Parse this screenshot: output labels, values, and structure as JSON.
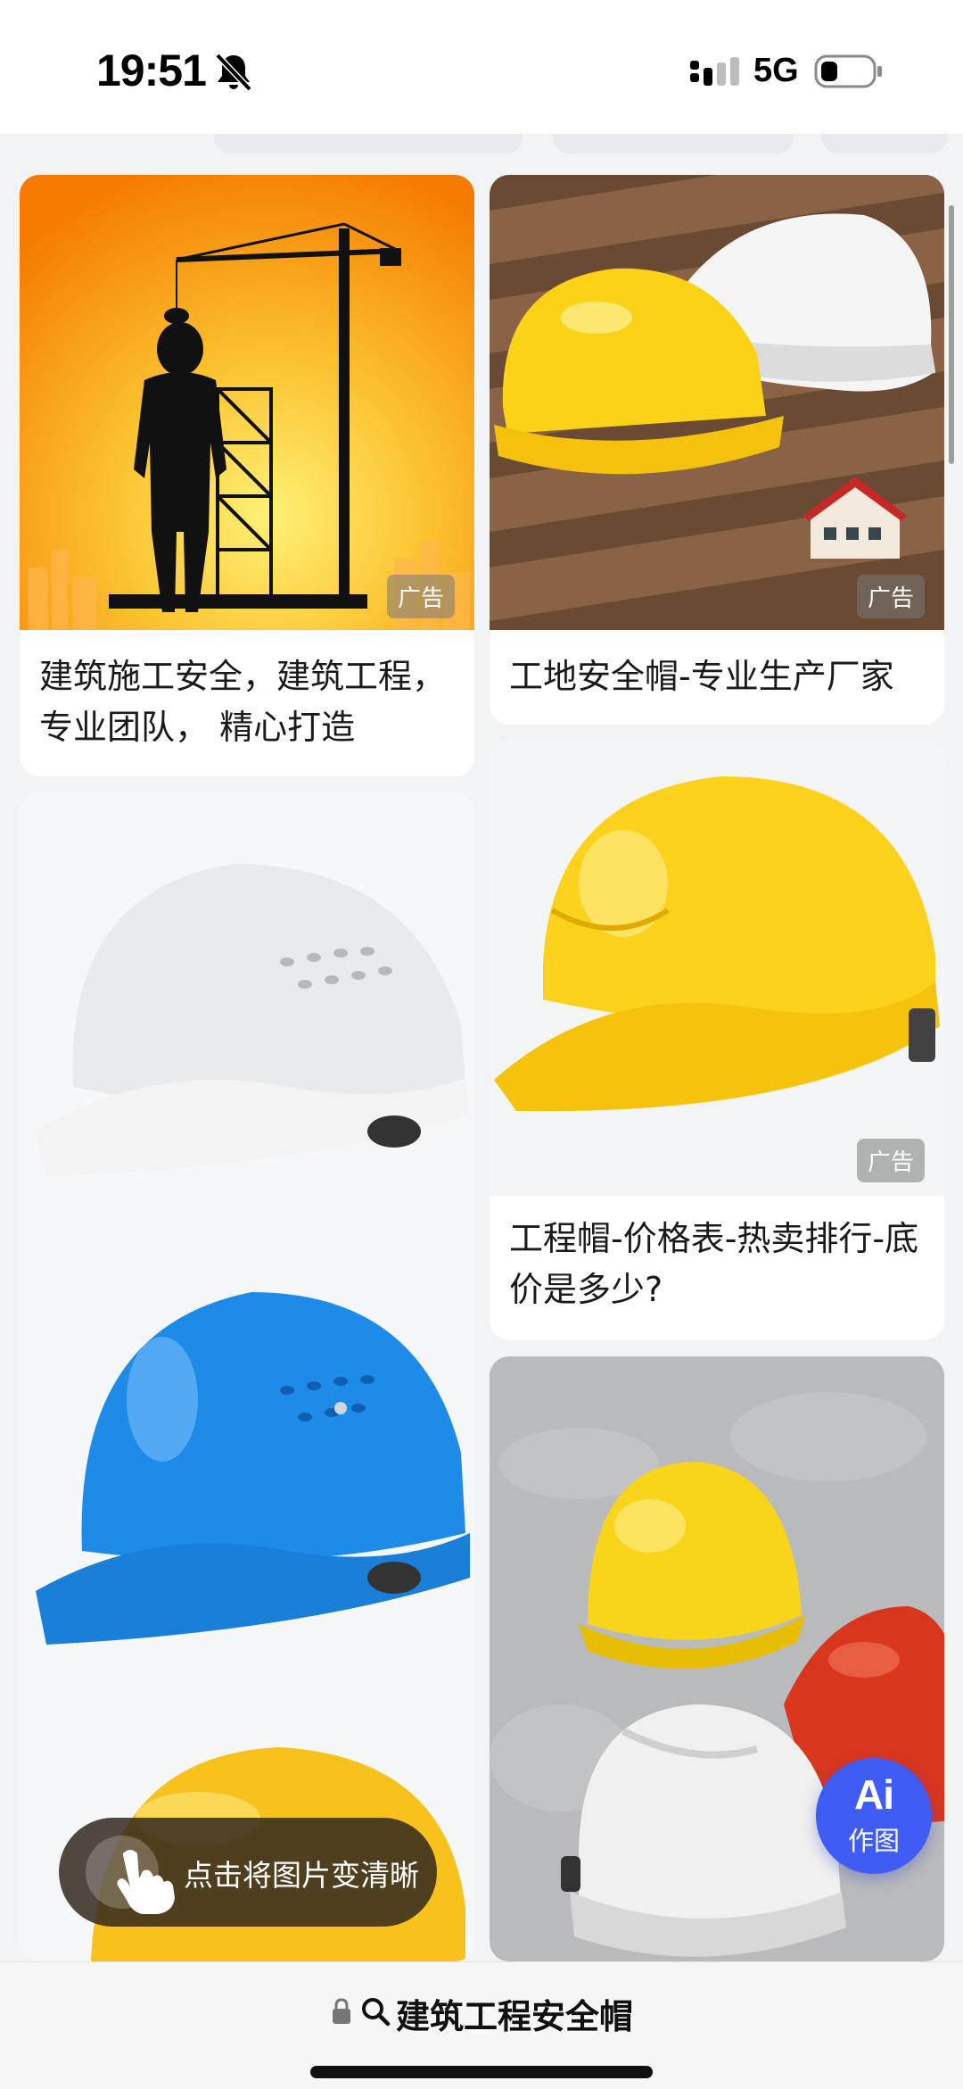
{
  "status_bar": {
    "time": "19:51",
    "network": "5G",
    "icons": [
      "bell-mute-icon",
      "signal-icon",
      "battery-icon"
    ]
  },
  "feed": {
    "cards": [
      {
        "title": "建筑施工安全，建筑工程，专业团队， 精心打造",
        "ad_label": "广告"
      },
      {
        "title": "工地安全帽-专业生产厂家",
        "ad_label": "广告"
      },
      {
        "title": "",
        "ad_label": ""
      },
      {
        "title": "工程帽-价格表-热卖排行-底价是多少?",
        "ad_label": "广告"
      },
      {
        "title": "",
        "ad_label": ""
      }
    ]
  },
  "tip": {
    "text": "点击将图片变清晰",
    "icon": "hand-tap-icon"
  },
  "ai_button": {
    "label": "Ai",
    "sub_label": "作图"
  },
  "search_bar": {
    "query": "建筑工程安全帽",
    "icons": [
      "lock-icon",
      "search-icon"
    ]
  },
  "colors": {
    "accent": "#3f5cf5",
    "background": "#f2f3f5"
  }
}
